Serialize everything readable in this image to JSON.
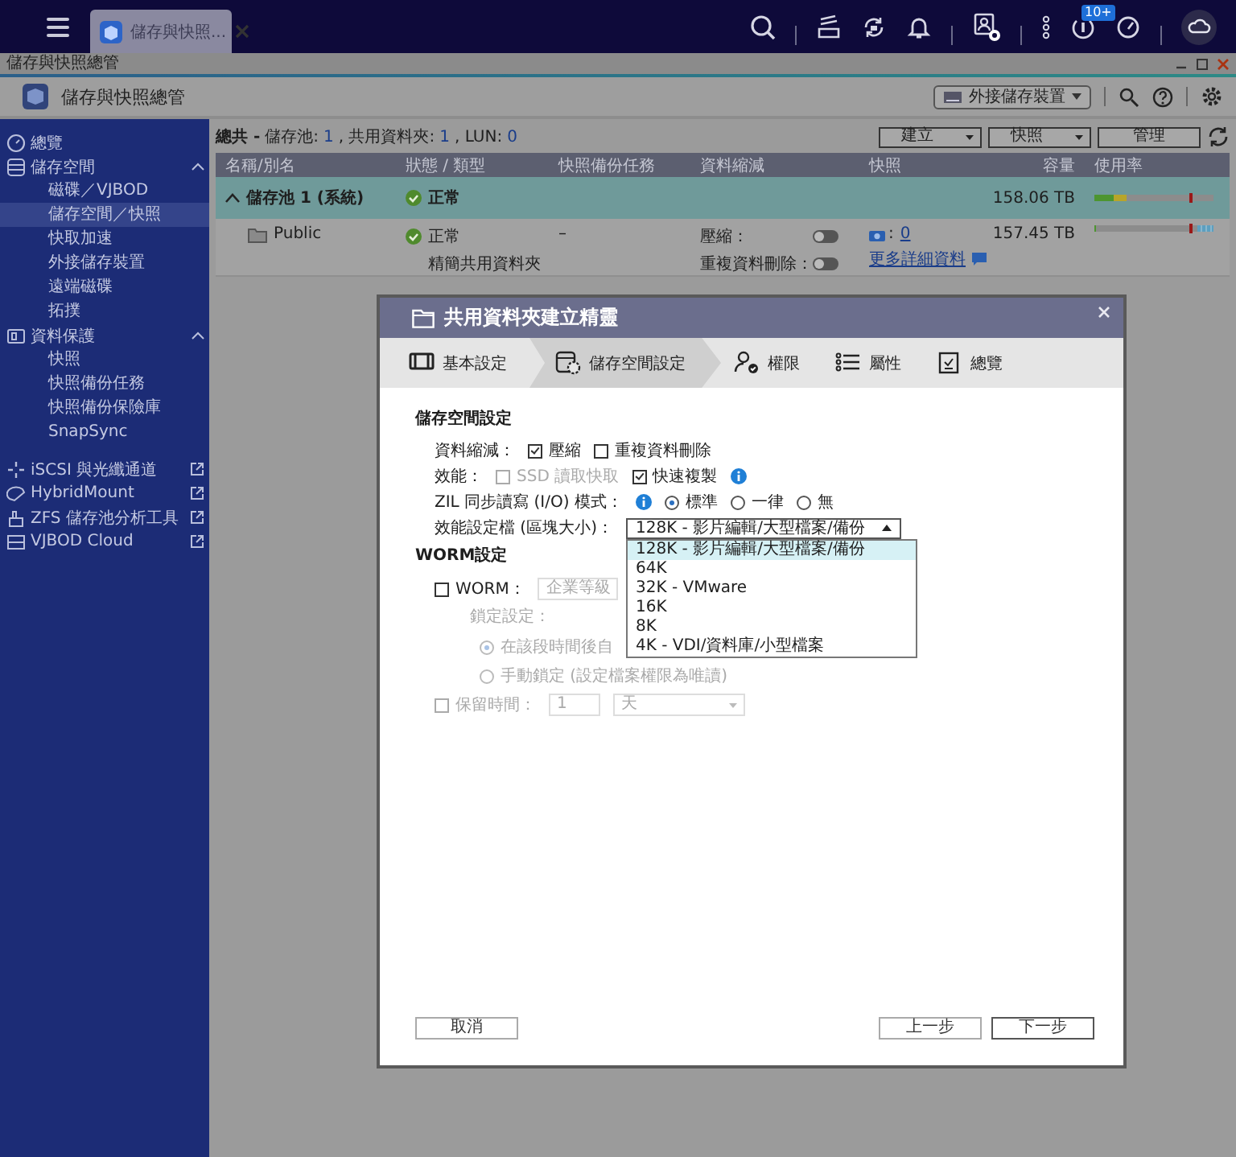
{
  "top_bar": {
    "tab": {
      "title": "儲存與快照...",
      "selected": true
    },
    "notification_badge": "10+"
  },
  "window": {
    "title": "儲存與快照總管"
  },
  "app_header": {
    "title": "儲存與快照總管",
    "external_storage_button": "外接儲存裝置"
  },
  "sidebar": {
    "items": [
      {
        "label": "總覽",
        "kind": "section",
        "selected": false
      },
      {
        "label": "儲存空間",
        "kind": "group",
        "selected": false,
        "expanded": true,
        "children": [
          {
            "label": "磁碟／VJBOD",
            "selected": false
          },
          {
            "label": "儲存空間／快照",
            "selected": true
          },
          {
            "label": "快取加速",
            "selected": false
          },
          {
            "label": "外接儲存裝置",
            "selected": false
          },
          {
            "label": "遠端磁碟",
            "selected": false
          },
          {
            "label": "拓撲",
            "selected": false
          }
        ]
      },
      {
        "label": "資料保護",
        "kind": "group",
        "selected": false,
        "expanded": true,
        "children": [
          {
            "label": "快照",
            "selected": false
          },
          {
            "label": "快照備份任務",
            "selected": false
          },
          {
            "label": "快照備份保險庫",
            "selected": false
          },
          {
            "label": "SnapSync",
            "selected": false
          }
        ]
      },
      {
        "label": "iSCSI 與光纖通道",
        "kind": "external",
        "selected": false
      },
      {
        "label": "HybridMount",
        "kind": "external",
        "selected": false
      },
      {
        "label": "ZFS 儲存池分析工具",
        "kind": "external",
        "selected": false
      },
      {
        "label": "VJBOD Cloud",
        "kind": "external",
        "selected": false
      }
    ]
  },
  "summary": {
    "prefix": "總共 -",
    "items": [
      {
        "label": "儲存池:",
        "value": "1"
      },
      {
        "label": ", 共用資料夾:",
        "value": "1"
      },
      {
        "label": ", LUN:",
        "value": "0"
      }
    ]
  },
  "toolbar": {
    "buttons": [
      {
        "label": "建立",
        "kind": "dropdown"
      },
      {
        "label": "快照",
        "kind": "dropdown"
      },
      {
        "label": "管理",
        "kind": "plain"
      }
    ]
  },
  "table": {
    "columns": [
      "名稱/別名",
      "狀態 / 類型",
      "快照備份任務",
      "資料縮減",
      "快照",
      "容量",
      "使用率"
    ],
    "rows": [
      {
        "kind": "pool",
        "name": "儲存池 1 (系統)",
        "expanded": true,
        "status": "正常",
        "capacity": "158.06 TB",
        "level": 0.27
      },
      {
        "kind": "folder",
        "name": "Public",
        "status": "正常",
        "type": "精簡共用資料夾",
        "backup": "–",
        "reductions": [
          {
            "label": "壓縮：",
            "on": false
          },
          {
            "label": "重複資料刪除：",
            "on": false
          }
        ],
        "snapshot_count": "0",
        "snapshot_separator": ":",
        "details_link": "更多詳細資料",
        "capacity": "157.45 TB",
        "level": 0.01
      }
    ]
  },
  "dialog": {
    "title": "共用資料夾建立精靈",
    "steps": [
      {
        "label": "基本設定",
        "selected": false
      },
      {
        "label": "儲存空間設定",
        "selected": true
      },
      {
        "label": "權限",
        "selected": false
      },
      {
        "label": "屬性",
        "selected": false
      },
      {
        "label": "總覽",
        "selected": false
      }
    ],
    "storage_heading": "儲存空間設定",
    "data_reduction": {
      "label": "資料縮減：",
      "options": [
        {
          "label": "壓縮",
          "checked": true,
          "disabled": false
        },
        {
          "label": "重複資料刪除",
          "checked": false,
          "disabled": false
        }
      ]
    },
    "performance": {
      "label": "效能：",
      "options": [
        {
          "label": "SSD 讀取快取",
          "checked": false,
          "disabled": true
        },
        {
          "label": "快速複製",
          "checked": true,
          "disabled": false
        }
      ]
    },
    "zil_mode": {
      "label": "ZIL 同步讀寫 (I/O) 模式：",
      "options": [
        {
          "label": "標準",
          "selected": true
        },
        {
          "label": "一律",
          "selected": false
        },
        {
          "label": "無",
          "selected": false
        }
      ]
    },
    "profile": {
      "label": "效能設定檔 (區塊大小)：",
      "value": "128K - 影片編輯/大型檔案/備份",
      "open": true,
      "options": [
        {
          "label": "128K - 影片編輯/大型檔案/備份",
          "selected": true
        },
        {
          "label": "64K",
          "selected": false
        },
        {
          "label": "32K - VMware",
          "selected": false
        },
        {
          "label": "16K",
          "selected": false
        },
        {
          "label": "8K",
          "selected": false
        },
        {
          "label": "4K - VDI/資料庫/小型檔案",
          "selected": false
        }
      ]
    },
    "worm_heading": "WORM設定",
    "worm": {
      "label": "WORM：",
      "checked": false,
      "level_value": "企業等級"
    },
    "lock_label": "鎖定設定：",
    "lock_options": [
      {
        "label": "在該段時間後自",
        "selected": true
      },
      {
        "label": "手動鎖定 (設定檔案權限為唯讀)",
        "selected": false
      }
    ],
    "retention": {
      "label": "保留時間：",
      "checked": false,
      "value": "1",
      "unit": "天"
    },
    "buttons": {
      "cancel": "取消",
      "back": "上一步",
      "next": "下一步"
    }
  }
}
